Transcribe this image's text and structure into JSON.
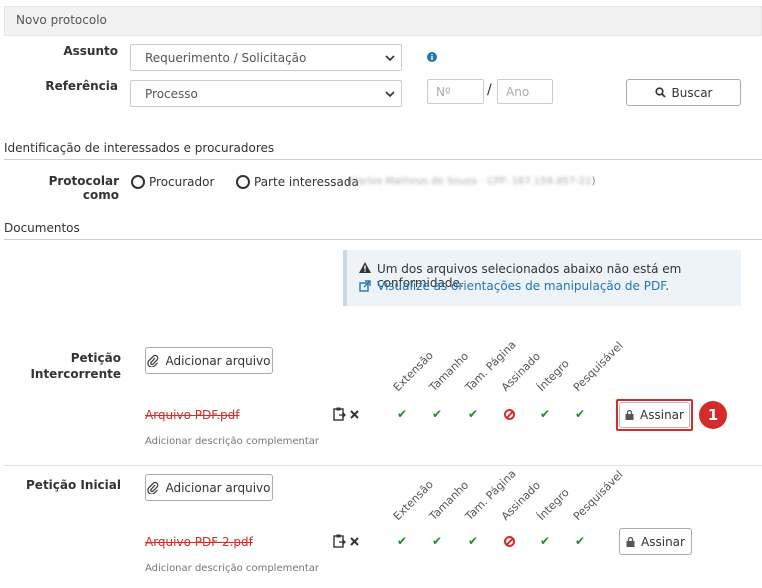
{
  "header": {
    "title": "Novo protocolo"
  },
  "form": {
    "assunto_label": "Assunto",
    "assunto_value": "Requerimento / Solicitação",
    "referencia_label": "Referência",
    "referencia_value": "Processo",
    "numero_placeholder": "Nº",
    "separator": "/",
    "ano_placeholder": "Ano",
    "buscar_label": "Buscar"
  },
  "interessados": {
    "section_title": "Identificação de interessados e procuradores",
    "protocolar_label": "Protocolar como",
    "option_procurador": "Procurador",
    "option_parte": "Parte interessada",
    "parte_detail_open": "(",
    "parte_detail_blurred": "Carlos Matheus de Souza - CPF: 167.159.857-22",
    "parte_detail_close": ")"
  },
  "documentos": {
    "section_title": "Documentos",
    "alert_text": "Um dos arquivos selecionados abaixo não está em conformidade.",
    "alert_link": "Visualize as orientações de manipulação de PDF",
    "alert_link_suffix": ".",
    "columns": [
      "Extensão",
      "Tamanho",
      "Tam. Página",
      "Assinado",
      "Íntegro",
      "Pesquisável"
    ],
    "add_file_label": "Adicionar arquivo",
    "desc_label": "Adicionar descrição complementar",
    "sign_label": "Assinar",
    "rows": [
      {
        "label_line1": "Petição",
        "label_line2": "Intercorrente",
        "file_name": "Arquivo PDF.pdf",
        "highlighted": true,
        "callout": "1"
      },
      {
        "label_line1": "Petição Inicial",
        "label_line2": "",
        "file_name": "Arquivo PDF 2.pdf",
        "highlighted": false
      }
    ],
    "status": [
      "ok",
      "ok",
      "ok",
      "fail",
      "ok",
      "ok"
    ]
  },
  "colors": {
    "accent_red": "#d62b2b",
    "check_green": "#1f8a2a",
    "link_blue": "#1f78b4",
    "info_blue": "#1f78b4"
  }
}
